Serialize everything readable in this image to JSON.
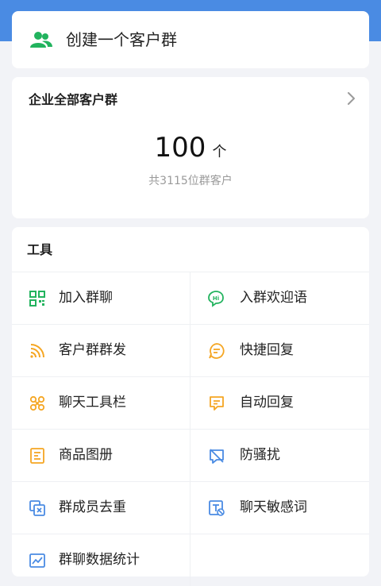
{
  "create": {
    "label": "创建一个客户群"
  },
  "groups": {
    "title": "企业全部客户群",
    "count": "100",
    "unit": "个",
    "summary": "共3115位群客户"
  },
  "tools": {
    "title": "工具",
    "items": [
      {
        "label": "加入群聊",
        "icon": "qr-code-icon"
      },
      {
        "label": "入群欢迎语",
        "icon": "hi-chat-icon"
      },
      {
        "label": "客户群群发",
        "icon": "broadcast-icon"
      },
      {
        "label": "快捷回复",
        "icon": "quick-reply-icon"
      },
      {
        "label": "聊天工具栏",
        "icon": "toolbar-icon"
      },
      {
        "label": "自动回复",
        "icon": "auto-reply-icon"
      },
      {
        "label": "商品图册",
        "icon": "catalog-icon"
      },
      {
        "label": "防骚扰",
        "icon": "no-disturb-icon"
      },
      {
        "label": "群成员去重",
        "icon": "dedupe-icon"
      },
      {
        "label": "聊天敏感词",
        "icon": "sensitive-word-icon"
      },
      {
        "label": "群聊数据统计",
        "icon": "stats-icon"
      }
    ]
  },
  "colors": {
    "accent": "#4a8be3",
    "green": "#22b35e",
    "orange": "#f5a623",
    "blue": "#4a8be3"
  }
}
